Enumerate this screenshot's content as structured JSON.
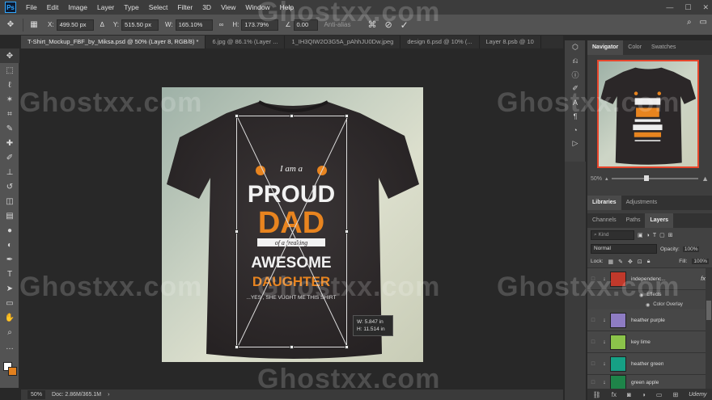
{
  "app": {
    "menus": [
      "File",
      "Edit",
      "Image",
      "Layer",
      "Type",
      "Select",
      "Filter",
      "3D",
      "View",
      "Window",
      "Help"
    ]
  },
  "options": {
    "x_label": "X:",
    "x_value": "499.50 px",
    "y_label": "Y:",
    "y_value": "515.50 px",
    "w_label": "W:",
    "w_value": "165.10%",
    "h_label": "H:",
    "h_value": "173.79%",
    "angle_value": "0.00",
    "antialias": "Anti-alias"
  },
  "tabs": [
    {
      "label": "T-Shirt_Mockup_FBF_by_Miksa.psd @ 50% (Layer 8, RGB/8) *",
      "active": true
    },
    {
      "label": "6.jpg @ 86.1% (Layer ...",
      "active": false
    },
    {
      "label": "1_IH3QIW2O3G5A_pAhhJU0Dw.jpeg",
      "active": false
    },
    {
      "label": "design 6.psd @ 10% (...",
      "active": false
    },
    {
      "label": "Layer 8.psb @ 10",
      "active": false
    }
  ],
  "design": {
    "line1": "I am a",
    "line2": "PROUD",
    "line3": "DAD",
    "line4": "of a freaking",
    "line5": "AWESOME",
    "line6": "DAUGHTER",
    "line7": "...YES , SHE VUGHT ME THIS SHIRT"
  },
  "transform_readout": {
    "w_label": "W:",
    "w_value": "5.847 in",
    "h_label": "H:",
    "h_value": "11.514 in"
  },
  "status": {
    "zoom": "50%",
    "doc": "Doc: 2.86M/365.1M"
  },
  "navigator": {
    "tabs": [
      "Navigator",
      "Color",
      "Swatches"
    ],
    "zoom": "50%"
  },
  "libraries_tabs": [
    "Libraries",
    "Adjustments"
  ],
  "layers_panel": {
    "tabs": [
      "Channels",
      "Paths",
      "Layers"
    ],
    "kind": "Kind",
    "blend_mode": "Normal",
    "opacity_label": "Opacity:",
    "opacity_value": "100%",
    "lock_label": "Lock:",
    "fill_label": "Fill:",
    "fill_value": "100%",
    "layers": [
      {
        "name": "independenc...",
        "color": "#c0392b",
        "fx": "fx"
      },
      {
        "name": "heather purple",
        "color": "#8e7cc3"
      },
      {
        "name": "key lime",
        "color": "#8bc34a"
      },
      {
        "name": "heather green",
        "color": "#16a085"
      },
      {
        "name": "green apple",
        "color": "#1e8449"
      }
    ],
    "effects_label": "Effects",
    "color_overlay_label": "Color Overlay"
  },
  "watermark": "Ghostxx.com",
  "footer_brand": "Udemy"
}
